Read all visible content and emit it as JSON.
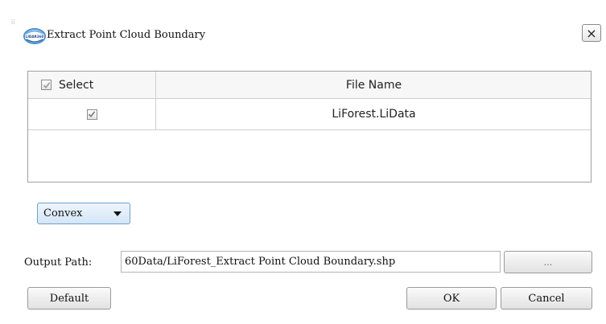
{
  "window": {
    "title": "Extract Point Cloud Boundary",
    "close_label": "×",
    "logo_icon": "lidar-globe-icon"
  },
  "table": {
    "columns": [
      "Select",
      "File Name"
    ],
    "select_all_checked": true,
    "rows": [
      {
        "checked": true,
        "file_name": "LiForest.LiData"
      }
    ]
  },
  "options": {
    "hull_type": "Convex"
  },
  "output": {
    "label": "Output Path:",
    "path": "60Data/LiForest_Extract Point Cloud Boundary.shp",
    "browse_label": "..."
  },
  "buttons": {
    "default": "Default",
    "ok": "OK",
    "cancel": "Cancel"
  },
  "colors": {
    "combo_border": "#6f9fd0",
    "combo_fill": "#dbe9f7"
  }
}
